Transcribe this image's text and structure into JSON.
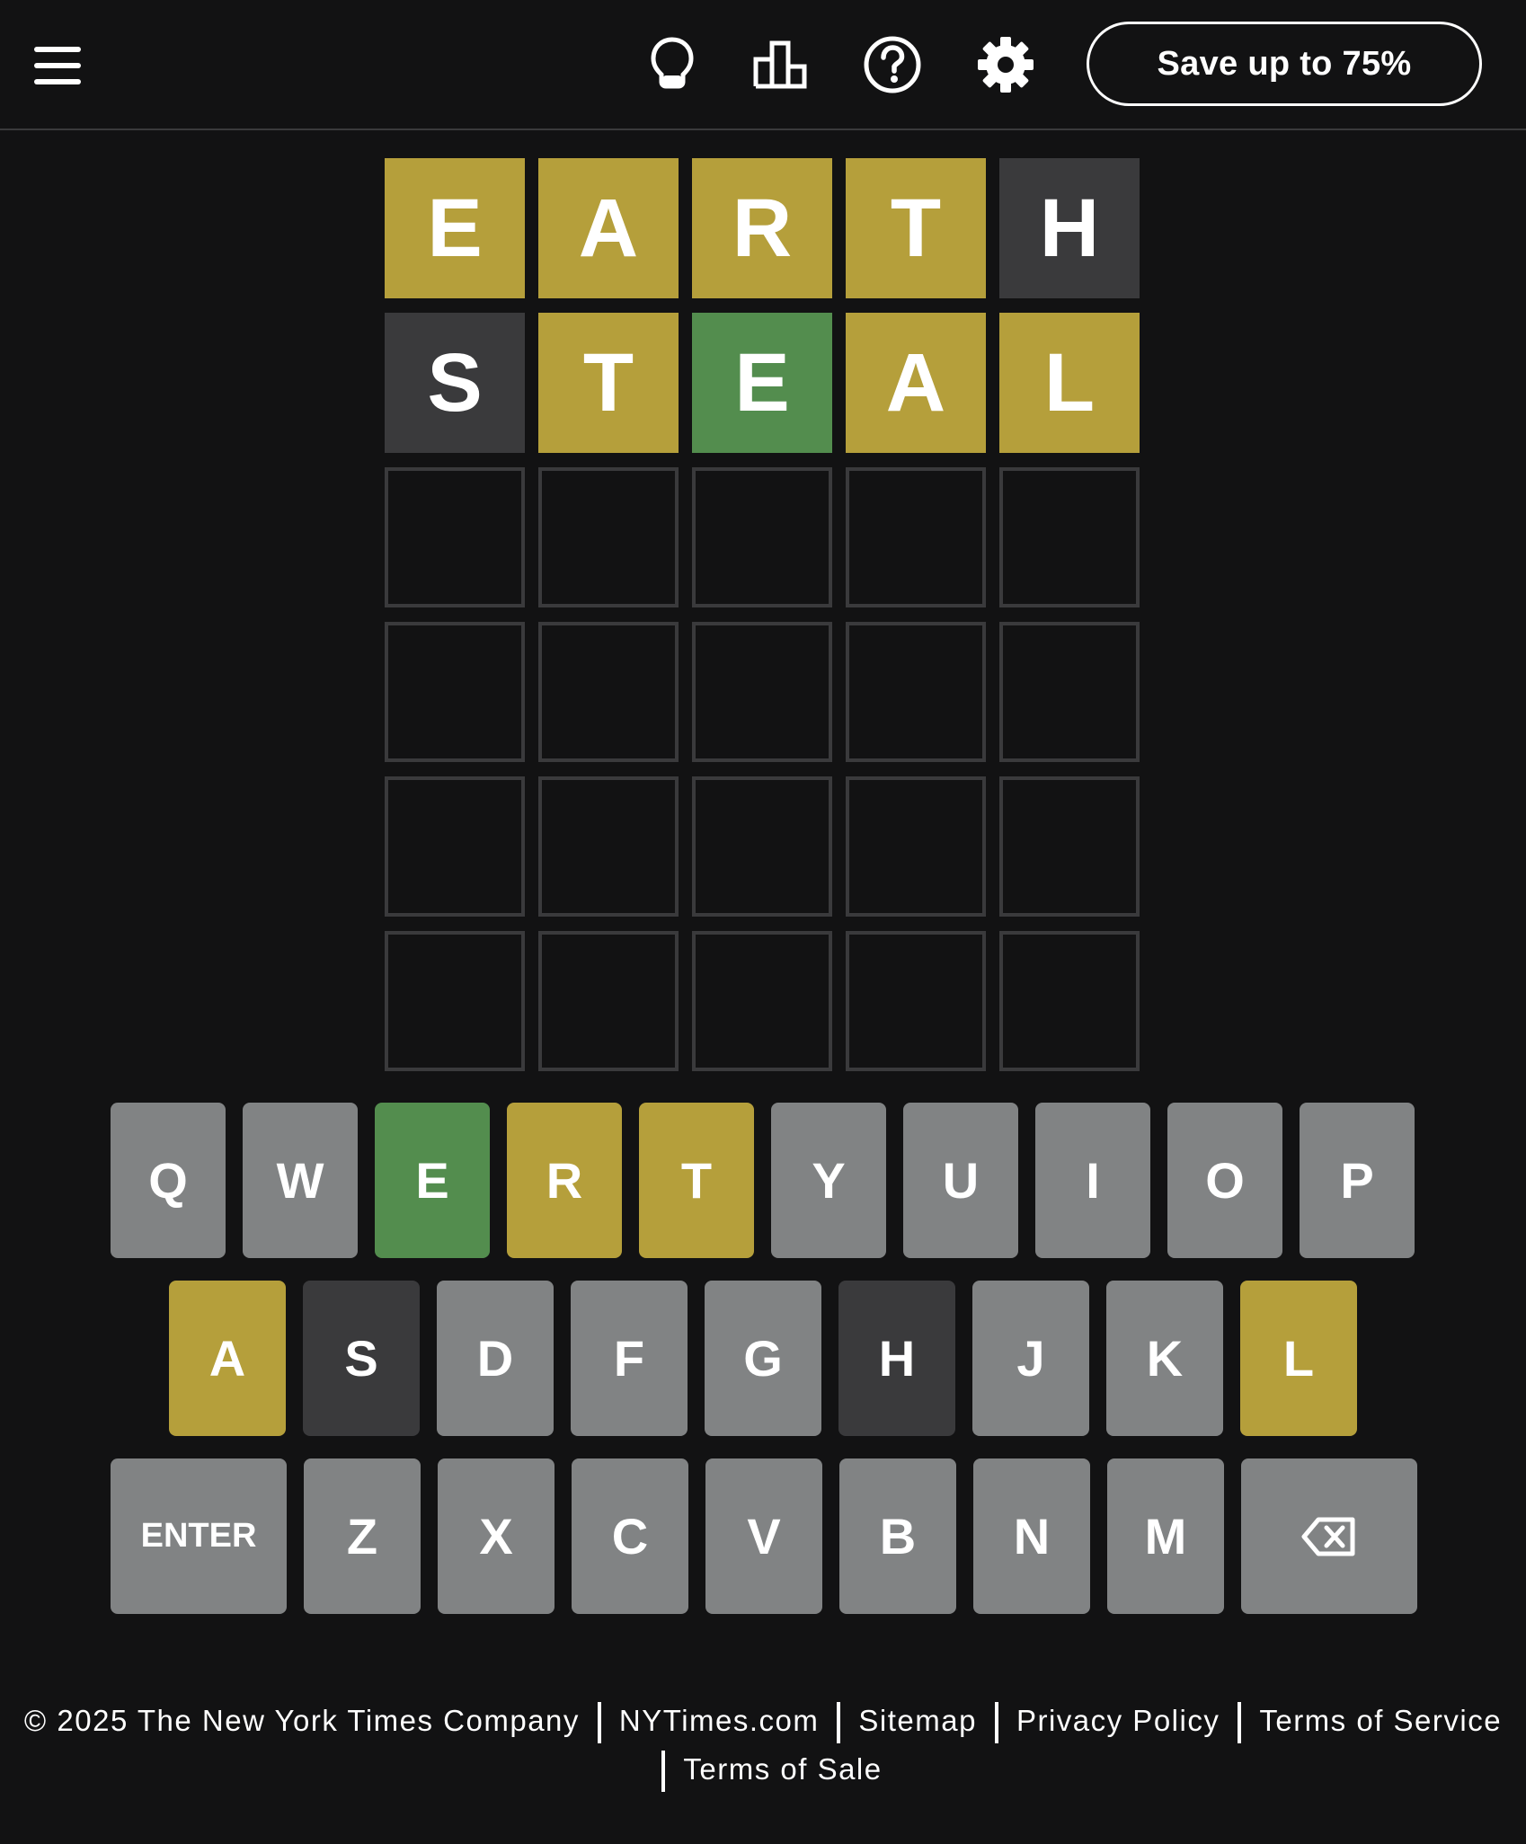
{
  "header": {
    "menu_icon": "hamburger-menu-icon",
    "icons": [
      "hint-bulb-icon",
      "stats-bar-chart-icon",
      "help-question-icon",
      "settings-gear-icon"
    ],
    "save_label": "Save up to 75%"
  },
  "board": {
    "rows": [
      [
        {
          "letter": "E",
          "state": "present"
        },
        {
          "letter": "A",
          "state": "present"
        },
        {
          "letter": "R",
          "state": "present"
        },
        {
          "letter": "T",
          "state": "present"
        },
        {
          "letter": "H",
          "state": "absent"
        }
      ],
      [
        {
          "letter": "S",
          "state": "absent"
        },
        {
          "letter": "T",
          "state": "present"
        },
        {
          "letter": "E",
          "state": "correct"
        },
        {
          "letter": "A",
          "state": "present"
        },
        {
          "letter": "L",
          "state": "present"
        }
      ],
      [
        {
          "letter": "",
          "state": "empty"
        },
        {
          "letter": "",
          "state": "empty"
        },
        {
          "letter": "",
          "state": "empty"
        },
        {
          "letter": "",
          "state": "empty"
        },
        {
          "letter": "",
          "state": "empty"
        }
      ],
      [
        {
          "letter": "",
          "state": "empty"
        },
        {
          "letter": "",
          "state": "empty"
        },
        {
          "letter": "",
          "state": "empty"
        },
        {
          "letter": "",
          "state": "empty"
        },
        {
          "letter": "",
          "state": "empty"
        }
      ],
      [
        {
          "letter": "",
          "state": "empty"
        },
        {
          "letter": "",
          "state": "empty"
        },
        {
          "letter": "",
          "state": "empty"
        },
        {
          "letter": "",
          "state": "empty"
        },
        {
          "letter": "",
          "state": "empty"
        }
      ],
      [
        {
          "letter": "",
          "state": "empty"
        },
        {
          "letter": "",
          "state": "empty"
        },
        {
          "letter": "",
          "state": "empty"
        },
        {
          "letter": "",
          "state": "empty"
        },
        {
          "letter": "",
          "state": "empty"
        }
      ]
    ]
  },
  "keyboard": {
    "rows": [
      [
        {
          "label": "Q",
          "state": "unused"
        },
        {
          "label": "W",
          "state": "unused"
        },
        {
          "label": "E",
          "state": "correct"
        },
        {
          "label": "R",
          "state": "present"
        },
        {
          "label": "T",
          "state": "present"
        },
        {
          "label": "Y",
          "state": "unused"
        },
        {
          "label": "U",
          "state": "unused"
        },
        {
          "label": "I",
          "state": "unused"
        },
        {
          "label": "O",
          "state": "unused"
        },
        {
          "label": "P",
          "state": "unused"
        }
      ],
      [
        {
          "label": "A",
          "state": "present"
        },
        {
          "label": "S",
          "state": "absent"
        },
        {
          "label": "D",
          "state": "unused"
        },
        {
          "label": "F",
          "state": "unused"
        },
        {
          "label": "G",
          "state": "unused"
        },
        {
          "label": "H",
          "state": "absent"
        },
        {
          "label": "J",
          "state": "unused"
        },
        {
          "label": "K",
          "state": "unused"
        },
        {
          "label": "L",
          "state": "present"
        }
      ],
      [
        {
          "label": "ENTER",
          "state": "unused",
          "wide": true
        },
        {
          "label": "Z",
          "state": "unused"
        },
        {
          "label": "X",
          "state": "unused"
        },
        {
          "label": "C",
          "state": "unused"
        },
        {
          "label": "V",
          "state": "unused"
        },
        {
          "label": "B",
          "state": "unused"
        },
        {
          "label": "N",
          "state": "unused"
        },
        {
          "label": "M",
          "state": "unused"
        },
        {
          "label": "",
          "icon": "backspace-icon",
          "state": "unused",
          "wide": true
        }
      ]
    ]
  },
  "footer": {
    "copyright": "© 2025 The New York Times Company",
    "links": [
      "NYTimes.com",
      "Sitemap",
      "Privacy Policy",
      "Terms of Service",
      "Terms of Sale"
    ]
  },
  "colors": {
    "background": "#121213",
    "correct": "#538d4e",
    "present": "#b59f3b",
    "absent": "#3a3a3c",
    "unused_key": "#818384",
    "empty_border": "#3a3a3c"
  }
}
